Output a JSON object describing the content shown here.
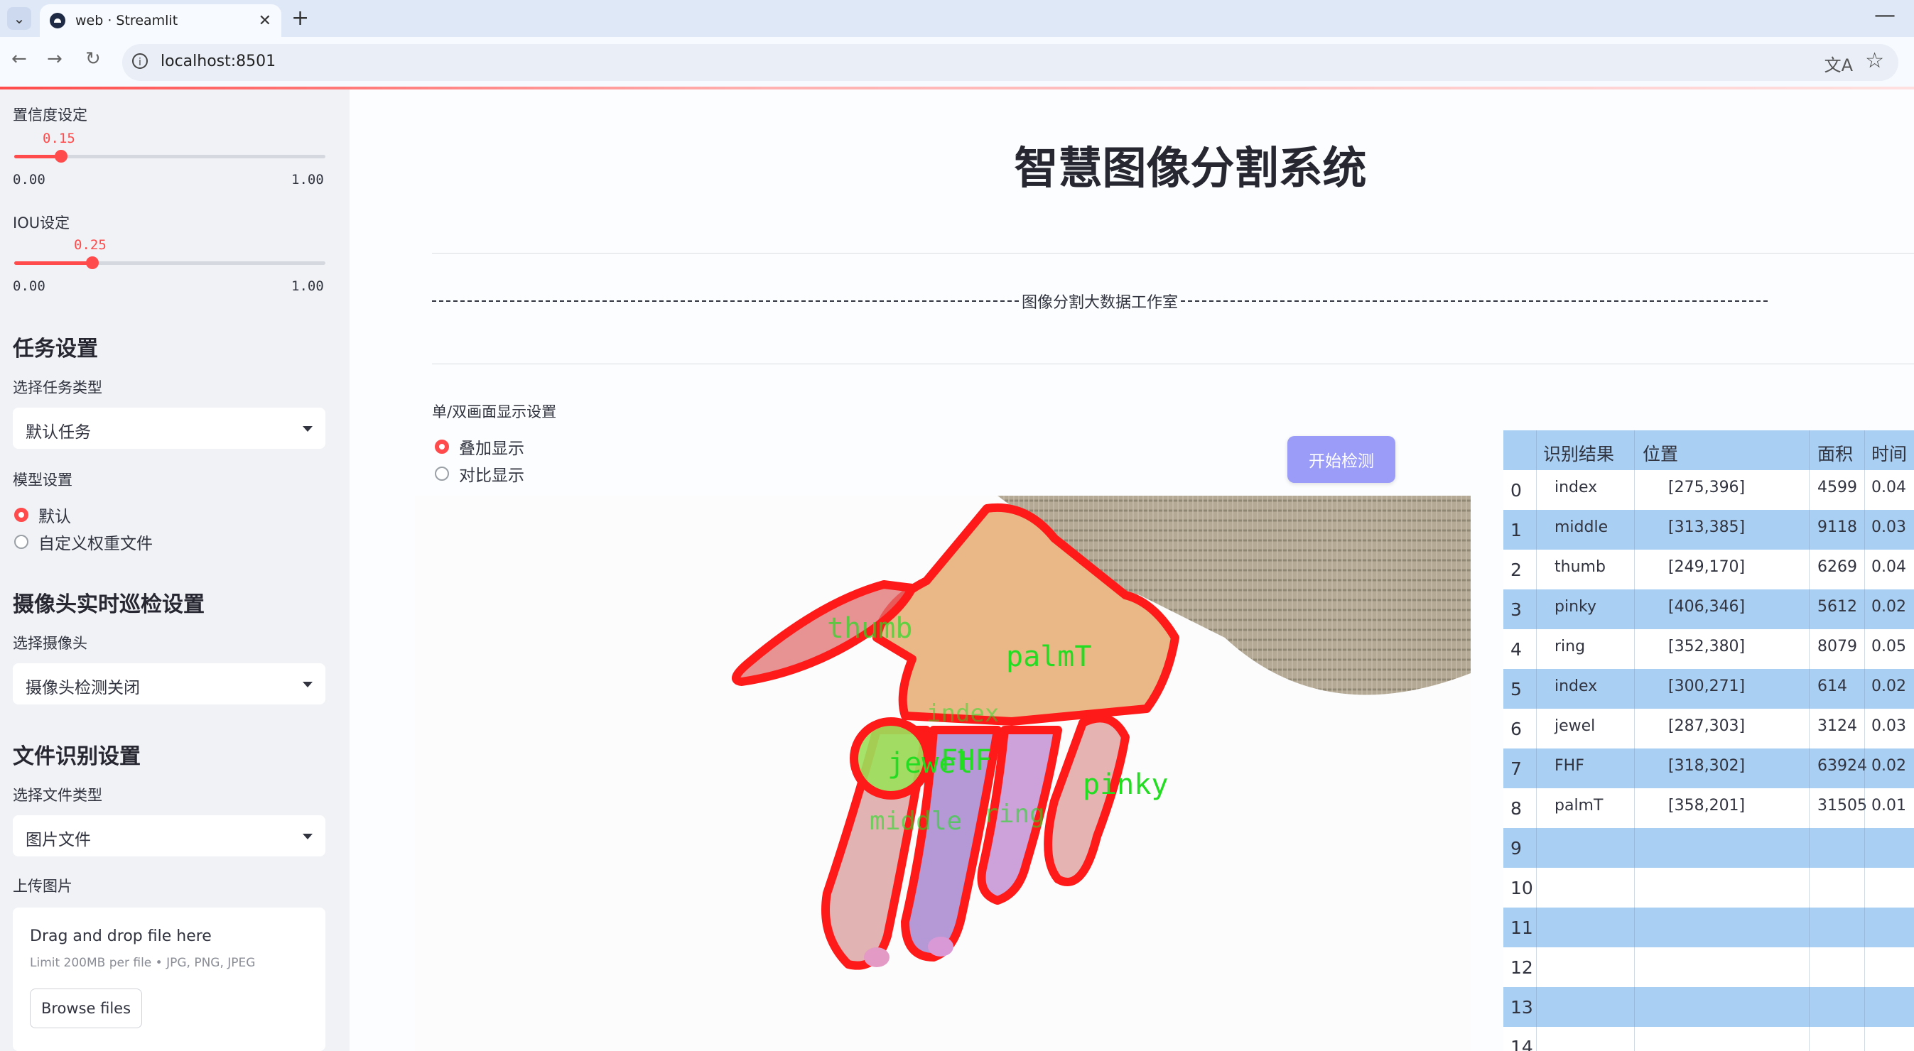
{
  "browser": {
    "tab_title": "web · Streamlit",
    "url": "localhost:8501"
  },
  "sidebar": {
    "confidence": {
      "label": "置信度设定",
      "value": "0.15",
      "min": "0.00",
      "max": "1.00",
      "fraction": 0.15
    },
    "iou": {
      "label": "IOU设定",
      "value": "0.25",
      "min": "0.00",
      "max": "1.00",
      "fraction": 0.25
    },
    "task_section": "任务设置",
    "task_type_label": "选择任务类型",
    "task_type_value": "默认任务",
    "model_label": "模型设置",
    "model_options": [
      "默认",
      "自定义权重文件"
    ],
    "model_selected": "默认",
    "camera_section": "摄像头实时巡检设置",
    "camera_label": "选择摄像头",
    "camera_value": "摄像头检测关闭",
    "file_section": "文件识别设置",
    "file_type_label": "选择文件类型",
    "file_type_value": "图片文件",
    "upload_label": "上传图片",
    "upload_drop": "Drag and drop file here",
    "upload_limit": "Limit 200MB per file • JPG, PNG, JPEG",
    "upload_button": "Browse files"
  },
  "main": {
    "title": "智慧图像分割系统",
    "banner": "图像分割大数据工作室",
    "display_label": "单/双画面显示设置",
    "display_options": [
      "叠加显示",
      "对比显示"
    ],
    "display_selected": "叠加显示",
    "detect_button": "开始检测"
  },
  "overlay_labels": [
    "thumb",
    "palmT",
    "index",
    "jewel",
    "FHF",
    "middle",
    "ring",
    "pinky"
  ],
  "colors": {
    "accent": "#ff4b4b",
    "table_header": "#a9cff3",
    "button": "#9b9cf8",
    "mask_outline": "#ff1a1a",
    "label_green": "#22dd22"
  },
  "table": {
    "headers": [
      "识别结果",
      "位置",
      "面积",
      "时间"
    ],
    "rows": [
      {
        "idx": "0",
        "result": "index",
        "position": "[275,396]",
        "area": "4599",
        "time": "0.04"
      },
      {
        "idx": "1",
        "result": "middle",
        "position": "[313,385]",
        "area": "9118",
        "time": "0.03"
      },
      {
        "idx": "2",
        "result": "thumb",
        "position": "[249,170]",
        "area": "6269",
        "time": "0.04"
      },
      {
        "idx": "3",
        "result": "pinky",
        "position": "[406,346]",
        "area": "5612",
        "time": "0.02"
      },
      {
        "idx": "4",
        "result": "ring",
        "position": "[352,380]",
        "area": "8079",
        "time": "0.05"
      },
      {
        "idx": "5",
        "result": "index",
        "position": "[300,271]",
        "area": "614",
        "time": "0.02"
      },
      {
        "idx": "6",
        "result": "jewel",
        "position": "[287,303]",
        "area": "3124",
        "time": "0.03"
      },
      {
        "idx": "7",
        "result": "FHF",
        "position": "[318,302]",
        "area": "63924",
        "time": "0.02"
      },
      {
        "idx": "8",
        "result": "palmT",
        "position": "[358,201]",
        "area": "31505",
        "time": "0.01"
      },
      {
        "idx": "9",
        "result": "",
        "position": "",
        "area": "",
        "time": ""
      },
      {
        "idx": "10",
        "result": "",
        "position": "",
        "area": "",
        "time": ""
      },
      {
        "idx": "11",
        "result": "",
        "position": "",
        "area": "",
        "time": ""
      },
      {
        "idx": "12",
        "result": "",
        "position": "",
        "area": "",
        "time": ""
      },
      {
        "idx": "13",
        "result": "",
        "position": "",
        "area": "",
        "time": ""
      },
      {
        "idx": "14",
        "result": "",
        "position": "",
        "area": "",
        "time": ""
      }
    ]
  }
}
